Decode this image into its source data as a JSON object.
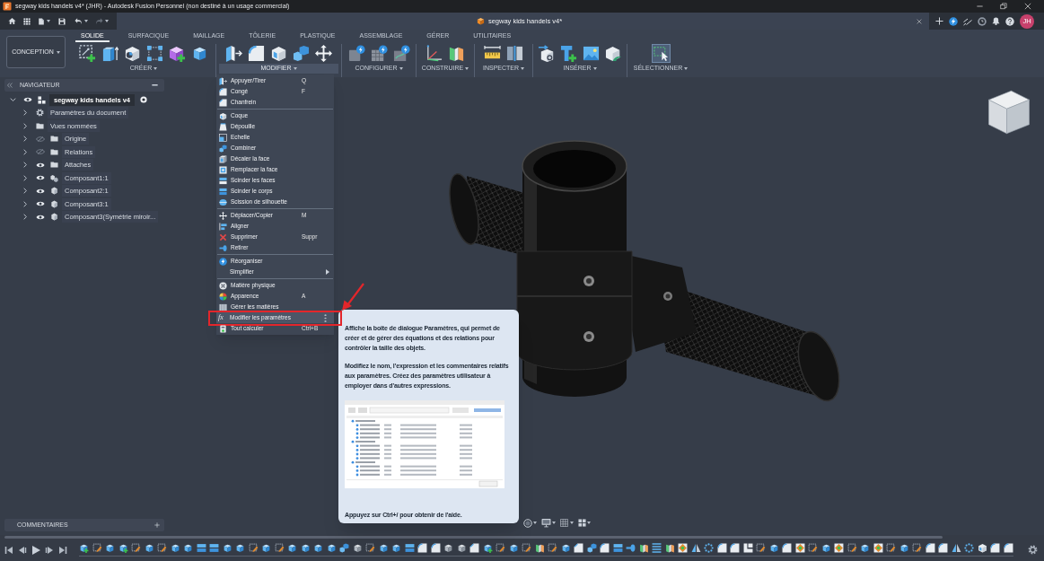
{
  "window": {
    "title": "segway kids handels v4* (JHR) - Autodesk Fusion Personnel (non destiné à un usage commercial)"
  },
  "quick_access": {
    "undo_disabled": false,
    "redo_disabled": true
  },
  "document_tab": {
    "title": "segway kids handels v4*"
  },
  "account": {
    "initials": "JH"
  },
  "workspace": {
    "label": "CONCEPTION"
  },
  "toolbar_tabs": [
    {
      "label": "SOLIDE",
      "selected": true
    },
    {
      "label": "SURFACIQUE",
      "selected": false
    },
    {
      "label": "MAILLAGE",
      "selected": false
    },
    {
      "label": "TÔLERIE",
      "selected": false
    },
    {
      "label": "PLASTIQUE",
      "selected": false
    },
    {
      "label": "ASSEMBLAGE",
      "selected": false
    },
    {
      "label": "GÉRER",
      "selected": false
    },
    {
      "label": "UTILITAIRES",
      "selected": false
    }
  ],
  "toolbar_groups": [
    {
      "label": "CRÉER",
      "expanded": false,
      "tool_active": false
    },
    {
      "label": "MODIFIER",
      "expanded": true,
      "tool_active": false
    },
    {
      "label": "CONFIGURER",
      "expanded": false,
      "tool_active": false
    },
    {
      "label": "CONSTRUIRE",
      "expanded": false,
      "tool_active": false
    },
    {
      "label": "INSPECTER",
      "expanded": false,
      "tool_active": false
    },
    {
      "label": "INSÉRER",
      "expanded": false,
      "tool_active": false
    },
    {
      "label": "SÉLECTIONNER",
      "expanded": false,
      "tool_active": true
    }
  ],
  "navigator": {
    "title": "NAVIGATEUR",
    "tree": [
      {
        "label": "segway kids handels v4",
        "kind": "document",
        "expanded": true,
        "visible": true,
        "active": true,
        "children": [
          {
            "label": "Paramètres du document",
            "kind": "settings",
            "expanded": false
          },
          {
            "label": "Vues nommées",
            "kind": "folder",
            "expanded": false
          },
          {
            "label": "Origine",
            "kind": "folder",
            "expanded": false,
            "visible": false
          },
          {
            "label": "Relations",
            "kind": "folder",
            "expanded": false,
            "visible": false
          },
          {
            "label": "Attaches",
            "kind": "folder",
            "expanded": false,
            "visible": true
          },
          {
            "label": "Composant1:1",
            "kind": "assembly",
            "expanded": false,
            "visible": true
          },
          {
            "label": "Composant2:1",
            "kind": "component",
            "expanded": false,
            "visible": true
          },
          {
            "label": "Composant3:1",
            "kind": "component",
            "expanded": false,
            "visible": true
          },
          {
            "label": "Composant3(Symétrie miroir...",
            "kind": "component",
            "expanded": false,
            "visible": true
          }
        ]
      }
    ]
  },
  "modify_menu": {
    "sections": [
      {
        "items": [
          {
            "label": "Appuyer/Tirer",
            "shortcut": "Q",
            "kind": "command",
            "selected": false,
            "annotated": false
          },
          {
            "label": "Congé",
            "shortcut": "F",
            "kind": "command",
            "selected": false,
            "annotated": false
          },
          {
            "label": "Chanfrein",
            "kind": "command",
            "selected": false,
            "annotated": false
          }
        ]
      },
      {
        "items": [
          {
            "label": "Coque",
            "kind": "command",
            "selected": false,
            "annotated": false
          },
          {
            "label": "Dépouille",
            "kind": "command",
            "selected": false,
            "annotated": false
          },
          {
            "label": "Echelle",
            "kind": "command",
            "selected": false,
            "annotated": false
          },
          {
            "label": "Combiner",
            "kind": "command",
            "selected": false,
            "annotated": false
          },
          {
            "label": "Décaler la face",
            "kind": "command",
            "selected": false,
            "annotated": false
          },
          {
            "label": "Remplacer la face",
            "kind": "command",
            "selected": false,
            "annotated": false
          },
          {
            "label": "Scinder les faces",
            "kind": "command",
            "selected": false,
            "annotated": false
          },
          {
            "label": "Scinder le corps",
            "kind": "command",
            "selected": false,
            "annotated": false
          },
          {
            "label": "Scission de silhouette",
            "kind": "command",
            "selected": false,
            "annotated": false
          }
        ]
      },
      {
        "items": [
          {
            "label": "Déplacer/Copier",
            "shortcut": "M",
            "kind": "command",
            "selected": false,
            "annotated": false
          },
          {
            "label": "Aligner",
            "kind": "command",
            "selected": false,
            "annotated": false
          },
          {
            "label": "Supprimer",
            "shortcut": "Suppr",
            "kind": "command",
            "selected": false,
            "annotated": false
          },
          {
            "label": "Retirer",
            "kind": "command",
            "selected": false,
            "annotated": false
          }
        ]
      },
      {
        "items": [
          {
            "label": "Réorganiser",
            "kind": "command",
            "selected": false,
            "annotated": false
          },
          {
            "label": "Simplifier",
            "kind": "submenu",
            "selected": false,
            "annotated": false
          }
        ]
      },
      {
        "items": [
          {
            "label": "Matière physique",
            "kind": "command",
            "selected": false,
            "annotated": false
          },
          {
            "label": "Apparence",
            "shortcut": "A",
            "kind": "command",
            "selected": false,
            "annotated": false
          },
          {
            "label": "Gérer les matières",
            "kind": "command",
            "selected": false,
            "annotated": false
          },
          {
            "label": "Modifier les paramètres",
            "icon_glyph": "fx",
            "kind": "command",
            "selected": true,
            "annotated": true
          },
          {
            "label": "Tout calculer",
            "shortcut": "Ctrl+B",
            "kind": "command",
            "selected": false,
            "annotated": false
          }
        ]
      }
    ]
  },
  "tooltip": {
    "paragraphs": [
      "Affiche la boite de dialogue Paramètres, qui permet de créer et de gérer des équations et des relations pour contrôler la taille des objets.",
      "Modifiez le nom, l'expression et les commentaires relatifs aux paramètres. Créez des paramètres utilisateur à employer dans d'autres expressions."
    ],
    "footer": "Appuyez sur Ctrl+/ pour obtenir de l'aide."
  },
  "comments_panel": {
    "title": "COMMENTAIRES"
  }
}
